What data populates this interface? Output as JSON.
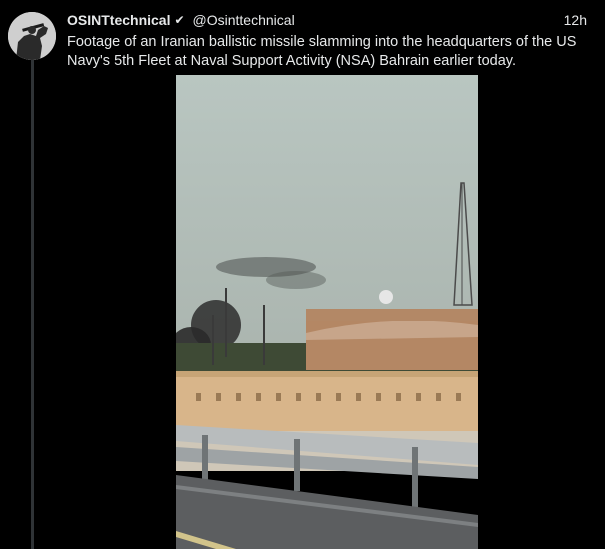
{
  "tweet": {
    "display_name": "OSINTtechnical",
    "verified_glyph": "✔",
    "handle": "@Osinttechnical",
    "time": "12h",
    "text": "Footage of an Iranian ballistic missile slamming into the headquarters of the US Navy's 5th Fleet at Naval Support Activity (NSA) Bahrain earlier today."
  },
  "icons": {
    "verified": "verified-check-icon",
    "avatar": "avatar-silhouette"
  },
  "colors": {
    "background": "#000000",
    "text": "#e7e9ea",
    "sky": "#aebbb5",
    "wall": "#d8b58a"
  }
}
